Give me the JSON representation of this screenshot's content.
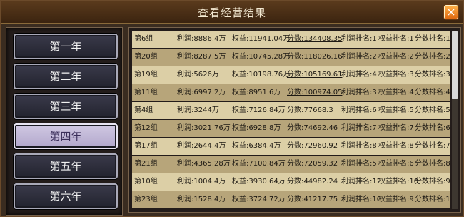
{
  "title": "查看经营结果",
  "close_icon": "×",
  "years": [
    "第一年",
    "第二年",
    "第三年",
    "第四年",
    "第五年",
    "第六年"
  ],
  "active_year": "第四年",
  "rows": [
    {
      "group": "第6组",
      "profit": "利润:8886.4万",
      "equity": "权益:11941.04万",
      "score": "分数:134408.35",
      "profit_rank": "利润排名:1",
      "equity_rank": "权益排名:1",
      "score_rank": "分数排名:1"
    },
    {
      "group": "第20组",
      "profit": "利润:8287.5万",
      "equity": "权益:10745.28万",
      "score": "分数:118026.16",
      "profit_rank": "利润排名:2",
      "equity_rank": "权益排名:2",
      "score_rank": "分数排名:2"
    },
    {
      "group": "第19组",
      "profit": "利润:5626万",
      "equity": "权益:10198.76万",
      "score": "分数:105169.61",
      "profit_rank": "利润排名:4",
      "equity_rank": "权益排名:3",
      "score_rank": "分数排名:3"
    },
    {
      "group": "第11组",
      "profit": "利润:6997.2万",
      "equity": "权益:8951.6万",
      "score": "分数:100974.05",
      "profit_rank": "利润排名:3",
      "equity_rank": "权益排名:4",
      "score_rank": "分数排名:4"
    },
    {
      "group": "第4组",
      "profit": "利润:3244万",
      "equity": "权益:7126.84万",
      "score": "分数:77668.3",
      "profit_rank": "利润排名:6",
      "equity_rank": "权益排名:5",
      "score_rank": "分数排名:5"
    },
    {
      "group": "第12组",
      "profit": "利润:3021.76万",
      "equity": "权益:6928.8万",
      "score": "分数:74692.46",
      "profit_rank": "利润排名:7",
      "equity_rank": "权益排名:7",
      "score_rank": "分数排名:6"
    },
    {
      "group": "第17组",
      "profit": "利润:2644.4万",
      "equity": "权益:6384.4万",
      "score": "分数:72960.92",
      "profit_rank": "利润排名:8",
      "equity_rank": "权益排名:8",
      "score_rank": "分数排名:7"
    },
    {
      "group": "第21组",
      "profit": "利润:4365.28万",
      "equity": "权益:7100.84万",
      "score": "分数:72059.32",
      "profit_rank": "利润排名:5",
      "equity_rank": "权益排名:6",
      "score_rank": "分数排名:8"
    },
    {
      "group": "第10组",
      "profit": "利润:1004.4万",
      "equity": "权益:3930.64万",
      "score": "分数:44982.24",
      "profit_rank": "利润排名:12",
      "equity_rank": "权益排名:10",
      "score_rank": "分数排名:9"
    },
    {
      "group": "第23组",
      "profit": "利润:1528.4万",
      "equity": "权益:3724.72万",
      "score": "分数:41217.75",
      "profit_rank": "利润排名:10",
      "equity_rank": "权益排名:9",
      "score_rank": "分数排名:10"
    }
  ]
}
